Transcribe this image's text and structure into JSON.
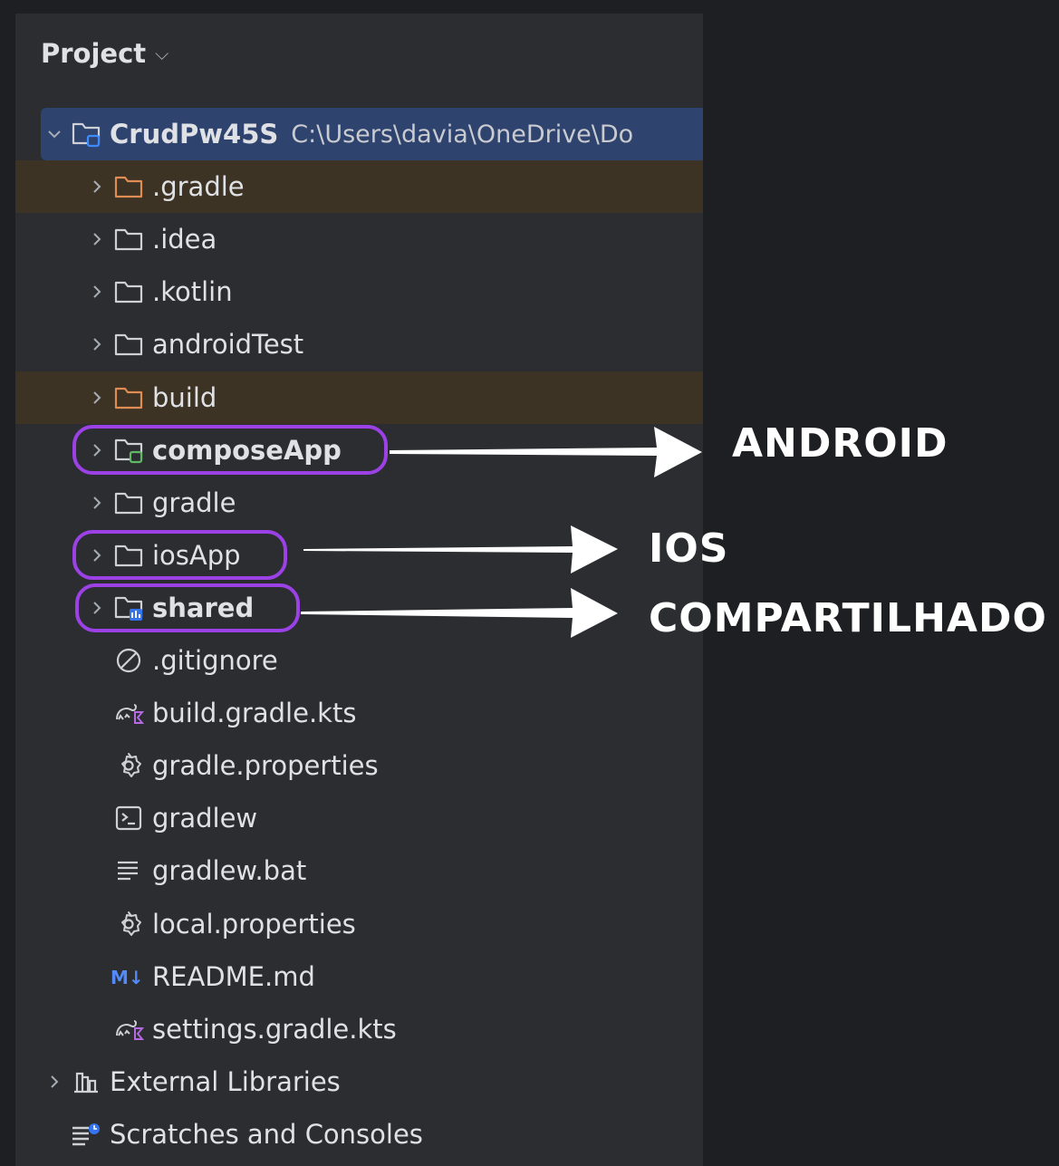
{
  "panel": {
    "title": "Project"
  },
  "tree": [
    {
      "label": "CrudPw45S",
      "path": "C:\\Users\\davia\\OneDrive\\Do",
      "icon": "module-folder-icon",
      "expanded": true,
      "level": 0,
      "bold": true
    },
    {
      "label": ".gradle",
      "icon": "folder-excluded-icon",
      "level": 1,
      "excluded": true
    },
    {
      "label": ".idea",
      "icon": "folder-icon",
      "level": 1
    },
    {
      "label": ".kotlin",
      "icon": "folder-icon",
      "level": 1
    },
    {
      "label": "androidTest",
      "icon": "folder-icon",
      "level": 1
    },
    {
      "label": "build",
      "icon": "folder-excluded-icon",
      "level": 1,
      "excluded": true
    },
    {
      "label": "composeApp",
      "icon": "android-module-folder-icon",
      "level": 1,
      "bold": true
    },
    {
      "label": "gradle",
      "icon": "folder-icon",
      "level": 1
    },
    {
      "label": "iosApp",
      "icon": "folder-icon",
      "level": 1
    },
    {
      "label": "shared",
      "icon": "library-module-folder-icon",
      "level": 1,
      "bold": true
    },
    {
      "label": ".gitignore",
      "icon": "ignore-icon",
      "level": 1,
      "leaf": true
    },
    {
      "label": "build.gradle.kts",
      "icon": "gradle-kotlin-icon",
      "level": 1,
      "leaf": true
    },
    {
      "label": "gradle.properties",
      "icon": "gear-icon",
      "level": 1,
      "leaf": true
    },
    {
      "label": "gradlew",
      "icon": "terminal-icon",
      "level": 1,
      "leaf": true
    },
    {
      "label": "gradlew.bat",
      "icon": "text-file-icon",
      "level": 1,
      "leaf": true
    },
    {
      "label": "local.properties",
      "icon": "gear-icon",
      "level": 1,
      "leaf": true
    },
    {
      "label": "README.md",
      "icon": "markdown-icon",
      "level": 1,
      "leaf": true
    },
    {
      "label": "settings.gradle.kts",
      "icon": "gradle-kotlin-icon",
      "level": 1,
      "leaf": true
    },
    {
      "label": "External Libraries",
      "icon": "libraries-icon",
      "level": 0
    },
    {
      "label": "Scratches and Consoles",
      "icon": "scratches-icon",
      "level": 0,
      "leaf": true
    }
  ],
  "annotations": {
    "android": "ANDROID",
    "ios": "IOS",
    "shared": "COMPARTILHADO"
  },
  "colors": {
    "highlight": "#9b41e6",
    "excluded_bg": "#3d3325",
    "selected_bg": "#2e436e",
    "panel_bg": "#2b2d30"
  }
}
